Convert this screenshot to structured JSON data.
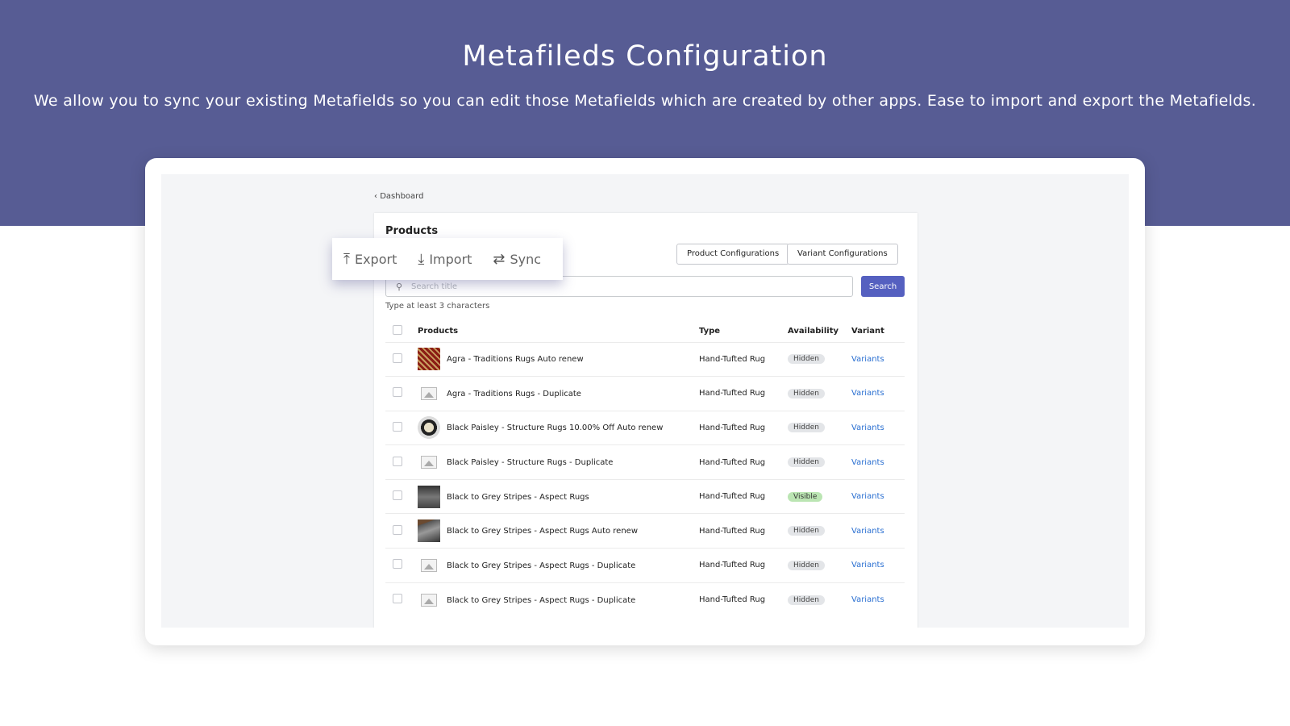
{
  "hero": {
    "title": "Metafileds Configuration",
    "subtitle": "We allow you to sync your existing Metafields so you can edit those Metafields which are created by other apps. Ease to import and export the Metafields."
  },
  "breadcrumb": "Dashboard",
  "card": {
    "title": "Products",
    "product_config": "Product Configurations",
    "variant_config": "Variant Configurations"
  },
  "search": {
    "placeholder": "Search title",
    "button": "Search",
    "hint": "Type at least 3 characters"
  },
  "toolbar": {
    "export": "Export",
    "import": "Import",
    "sync": "Sync"
  },
  "table": {
    "headers": [
      "Products",
      "Type",
      "Availability",
      "Variant"
    ],
    "rows": [
      {
        "name": "Agra - Traditions Rugs Auto renew",
        "type": "Hand-Tufted Rug",
        "availability": "Hidden",
        "variant": "Variants",
        "thumb": "red-rug"
      },
      {
        "name": "Agra - Traditions Rugs - Duplicate",
        "type": "Hand-Tufted Rug",
        "availability": "Hidden",
        "variant": "Variants",
        "thumb": "placeholder"
      },
      {
        "name": "Black Paisley - Structure Rugs 10.00% Off Auto renew",
        "type": "Hand-Tufted Rug",
        "availability": "Hidden",
        "variant": "Variants",
        "thumb": "paisley-rug"
      },
      {
        "name": "Black Paisley - Structure Rugs - Duplicate",
        "type": "Hand-Tufted Rug",
        "availability": "Hidden",
        "variant": "Variants",
        "thumb": "placeholder"
      },
      {
        "name": "Black to Grey Stripes - Aspect Rugs",
        "type": "Hand-Tufted Rug",
        "availability": "Visible",
        "variant": "Variants",
        "thumb": "grey-rug"
      },
      {
        "name": "Black to Grey Stripes - Aspect Rugs Auto renew",
        "type": "Hand-Tufted Rug",
        "availability": "Hidden",
        "variant": "Variants",
        "thumb": "grey-rug-floor"
      },
      {
        "name": "Black to Grey Stripes - Aspect Rugs - Duplicate",
        "type": "Hand-Tufted Rug",
        "availability": "Hidden",
        "variant": "Variants",
        "thumb": "placeholder"
      },
      {
        "name": "Black to Grey Stripes - Aspect Rugs - Duplicate",
        "type": "Hand-Tufted Rug",
        "availability": "Hidden",
        "variant": "Variants",
        "thumb": "placeholder"
      }
    ]
  }
}
